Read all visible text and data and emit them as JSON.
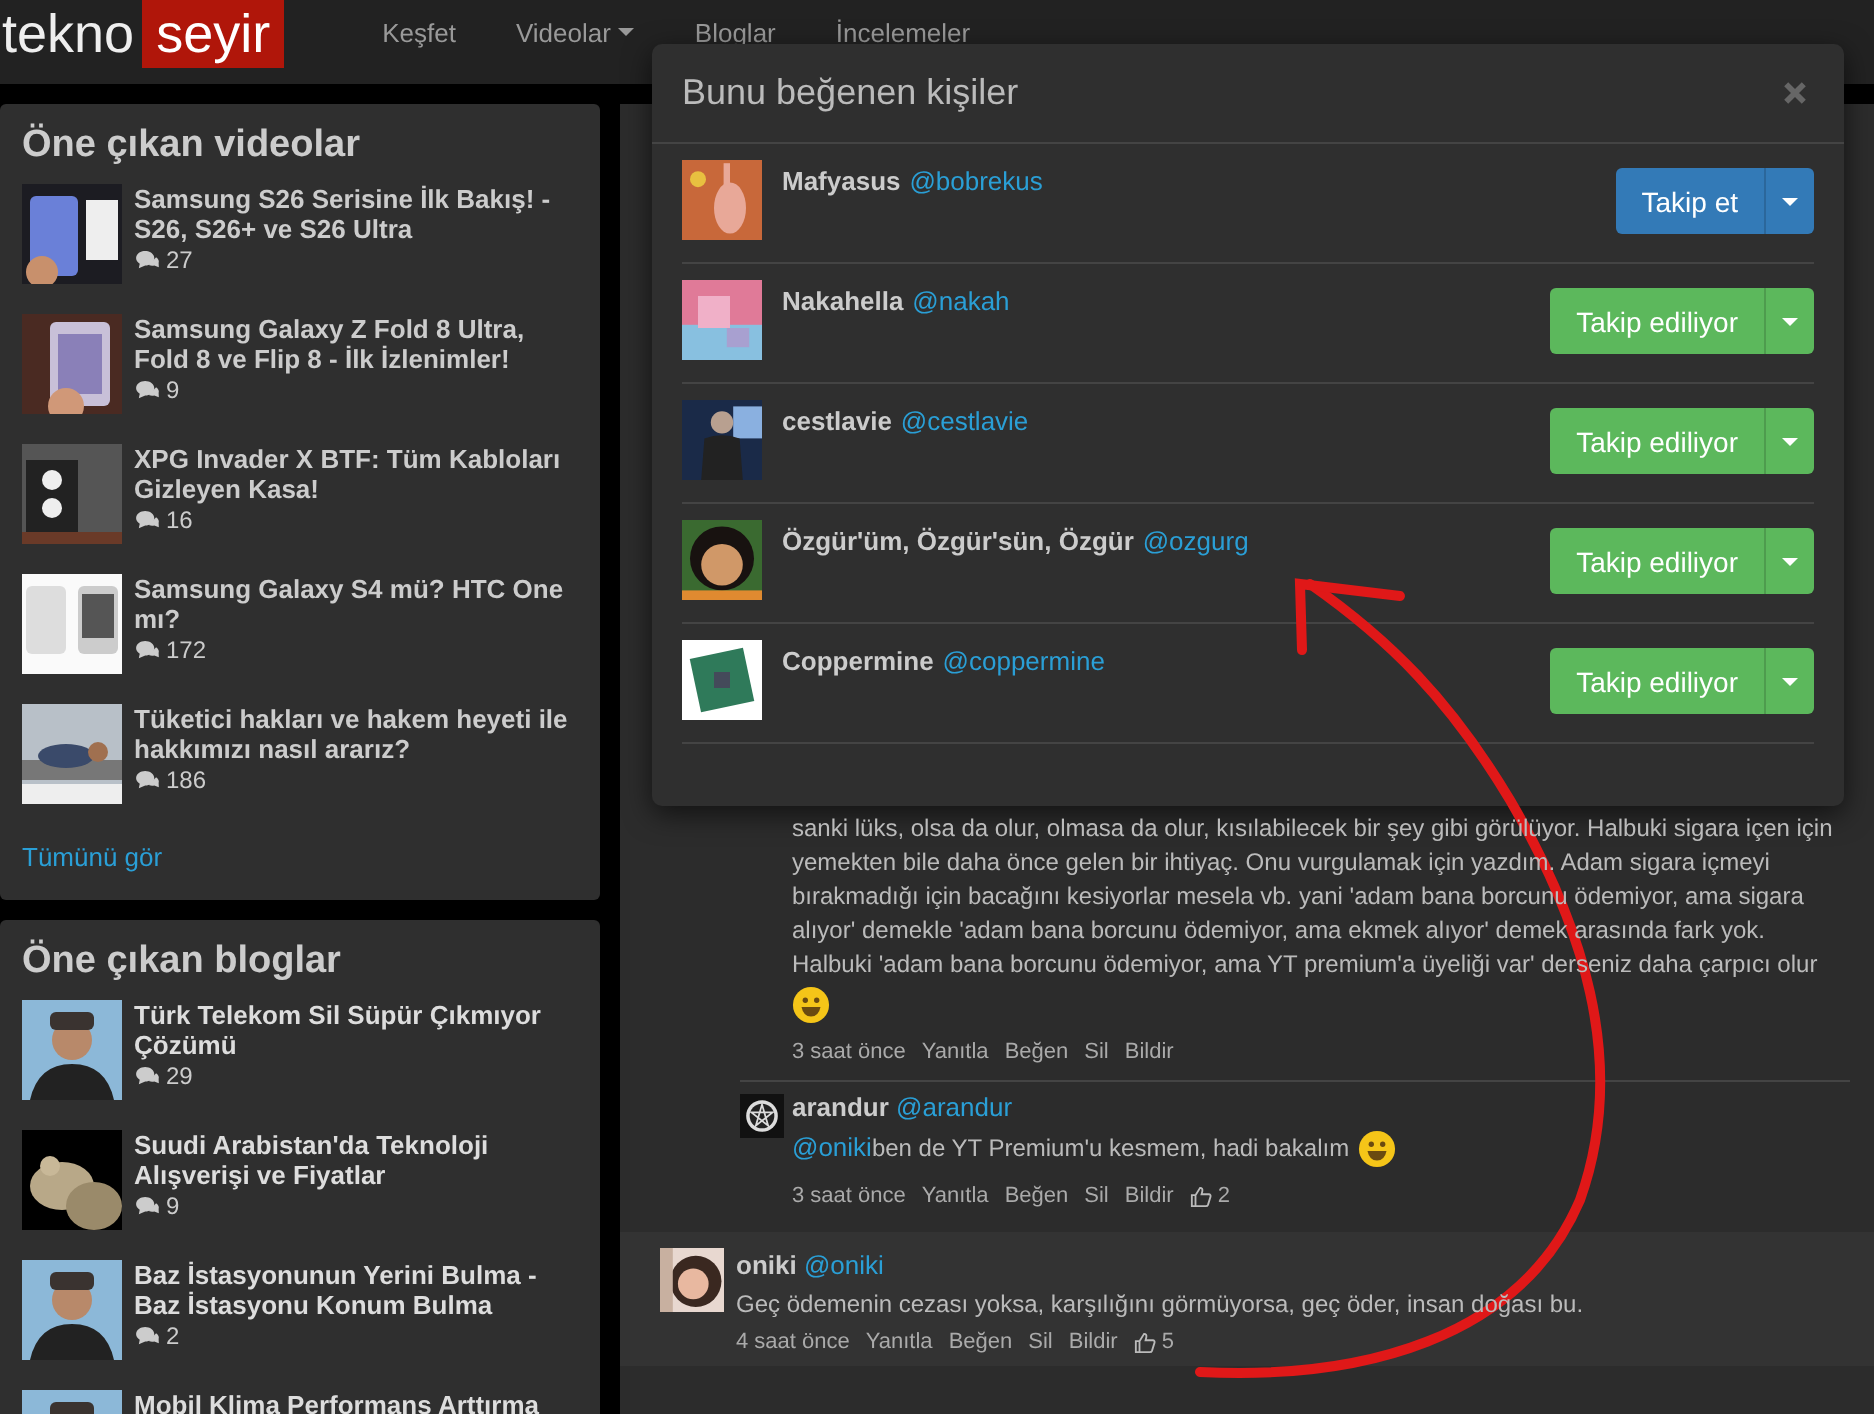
{
  "logo": {
    "first": "tekno",
    "second": "seyir"
  },
  "nav": [
    {
      "label": "Keşfet",
      "dropdown": false
    },
    {
      "label": "Videolar",
      "dropdown": true
    },
    {
      "label": "Bloglar",
      "dropdown": false
    },
    {
      "label": "İncelemeler",
      "dropdown": false
    }
  ],
  "featured_videos": {
    "title": "Öne çıkan videolar",
    "items": [
      {
        "title": "Samsung S26 Serisine İlk Bakış! - S26, S26+ ve S26 Ultra",
        "comments": "27"
      },
      {
        "title": "Samsung Galaxy Z Fold 8 Ultra, Fold 8 ve Flip 8 - İlk İzlenimler!",
        "comments": "9"
      },
      {
        "title": "XPG Invader X BTF: Tüm Kabloları Gizleyen Kasa!",
        "comments": "16"
      },
      {
        "title": "Samsung Galaxy S4 mü? HTC One mı?",
        "comments": "172"
      },
      {
        "title": "Tüketici hakları ve hakem heyeti ile hakkımızı nasıl ararız?",
        "comments": "186"
      }
    ],
    "more_link": "Tümünü gör"
  },
  "featured_blogs": {
    "title": "Öne çıkan bloglar",
    "items": [
      {
        "title": "Türk Telekom Sil Süpür Çıkmıyor Çözümü",
        "comments": "29"
      },
      {
        "title": "Suudi Arabistan'da Teknoloji Alışverişi ve Fiyatlar",
        "comments": "9"
      },
      {
        "title": "Baz İstasyonunun Yerini Bulma - Baz İstasyonu Konum Bulma",
        "comments": "2"
      },
      {
        "title": "Mobil Klima Performans Arttırma"
      }
    ]
  },
  "comments": [
    {
      "text": "sanki lüks, olsa da olur, olmasa da olur, kısılabilecek bir şey gibi görülüyor. Halbuki sigara içen için yemekten bile daha önce gelen bir ihtiyaç. Onu vurgulamak için yazdım. Adam sigara içmeyi bırakmadığı için bacağını kesiyorlar mesela vb. yani 'adam bana borcunu ödemiyor, ama sigara alıyor' demekle 'adam bana borcunu ödemiyor, ama ekmek alıyor' demek arasında fark yok. Halbuki 'adam bana borcunu ödemiyor, ama YT premium'a üyeliği var' derseniz daha çarpıcı olur",
      "emoji": true,
      "time": "3 saat önce",
      "actions": [
        "Yanıtla",
        "Beğen",
        "Sil",
        "Bildir"
      ]
    },
    {
      "author": "arandur",
      "handle": "@arandur",
      "mention": "@oniki",
      "text": "ben de YT Premium'u kesmem, hadi bakalım",
      "emoji": true,
      "time": "3 saat önce",
      "actions": [
        "Yanıtla",
        "Beğen",
        "Sil",
        "Bildir"
      ],
      "likes": "2"
    }
  ],
  "top_comment": {
    "author": "oniki",
    "handle": "@oniki",
    "text": "Geç ödemenin cezası yoksa, karşılığını görmüyorsa, geç öder, insan doğası bu.",
    "time": "4 saat önce",
    "actions": [
      "Yanıtla",
      "Beğen",
      "Sil",
      "Bildir"
    ],
    "likes": "5"
  },
  "modal": {
    "title": "Bunu beğenen kişiler",
    "users": [
      {
        "name": "Mafyasus",
        "handle": "@bobrekus",
        "following": false,
        "button": "Takip et"
      },
      {
        "name": "Nakahella",
        "handle": "@nakah",
        "following": true,
        "button": "Takip ediliyor"
      },
      {
        "name": "cestlavie",
        "handle": "@cestlavie",
        "following": true,
        "button": "Takip ediliyor"
      },
      {
        "name": "Özgür'üm, Özgür'sün, Özgür",
        "handle": "@ozgurg",
        "following": true,
        "button": "Takip ediliyor"
      },
      {
        "name": "Coppermine",
        "handle": "@coppermine",
        "following": true,
        "button": "Takip ediliyor"
      }
    ]
  }
}
